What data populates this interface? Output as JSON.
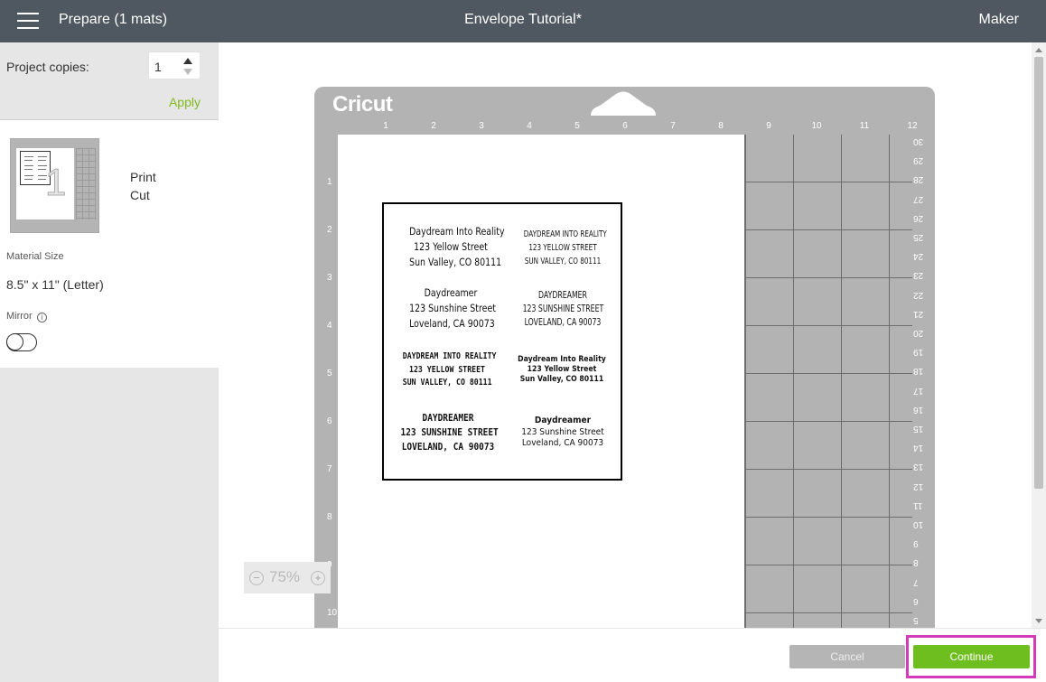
{
  "header": {
    "menu_icon": "hamburger-icon",
    "title": "Prepare (1 mats)",
    "project_name": "Envelope Tutorial*",
    "machine": "Maker"
  },
  "sidebar": {
    "copies_label": "Project copies:",
    "copies_value": "1",
    "apply_label": "Apply",
    "mat": {
      "number": "1",
      "print_label": "Print",
      "cut_label": "Cut"
    },
    "material_size_label": "Material Size",
    "material_size_value": "8.5\" x 11\" (Letter)",
    "mirror_label": "Mirror",
    "mirror_on": false
  },
  "mat": {
    "brand": "Cricut",
    "ruler_top": [
      "1",
      "2",
      "3",
      "4",
      "5",
      "6",
      "7",
      "8",
      "9",
      "10",
      "11",
      "12"
    ],
    "ruler_left": [
      "1",
      "2",
      "3",
      "4",
      "5",
      "6",
      "7",
      "8",
      "9",
      "10"
    ],
    "ruler_right": [
      "30",
      "29",
      "28",
      "27",
      "26",
      "25",
      "24",
      "23",
      "22",
      "21",
      "20",
      "19",
      "18",
      "17",
      "16",
      "15",
      "14",
      "13",
      "12",
      "11",
      "10",
      "9",
      "8",
      "7",
      "6",
      "5"
    ]
  },
  "addresses": [
    {
      "lines": [
        "Daydream Into Reality",
        "123 Yellow Street",
        "Sun Valley, CO 80111"
      ]
    },
    {
      "lines": [
        "DAYDREAM INTO REALITY",
        "123 YELLOW STREET",
        "SUN VALLEY, CO 80111"
      ]
    },
    {
      "lines": [
        "Daydreamer",
        "123 Sunshine Street",
        "Loveland, CA 90073"
      ]
    },
    {
      "lines": [
        "DAYDREAMER",
        "123 SUNSHINE STREET",
        "LOVELAND, CA 90073"
      ]
    },
    {
      "lines": [
        "DAYDREAM INTO REALITY",
        "123 YELLOW STREET",
        "SUN VALLEY, CO 80111"
      ]
    },
    {
      "lines": [
        "Daydream Into Reality",
        "123 Yellow Street",
        "Sun Valley, CO 80111"
      ]
    },
    {
      "lines": [
        "DAYDREAMER",
        "123 SUNSHINE STREET",
        "LOVELAND, CA 90073"
      ]
    },
    {
      "lines": [
        "Daydreamer",
        "123 Sunshine Street",
        "Loveland, CA 90073"
      ]
    }
  ],
  "zoom": {
    "value": "75%",
    "minus": "−",
    "plus": "+"
  },
  "footer": {
    "cancel_label": "Cancel",
    "continue_label": "Continue"
  },
  "colors": {
    "topbar": "#4f5860",
    "accent_green": "#6fbe1f",
    "highlight": "#d33bb8"
  }
}
